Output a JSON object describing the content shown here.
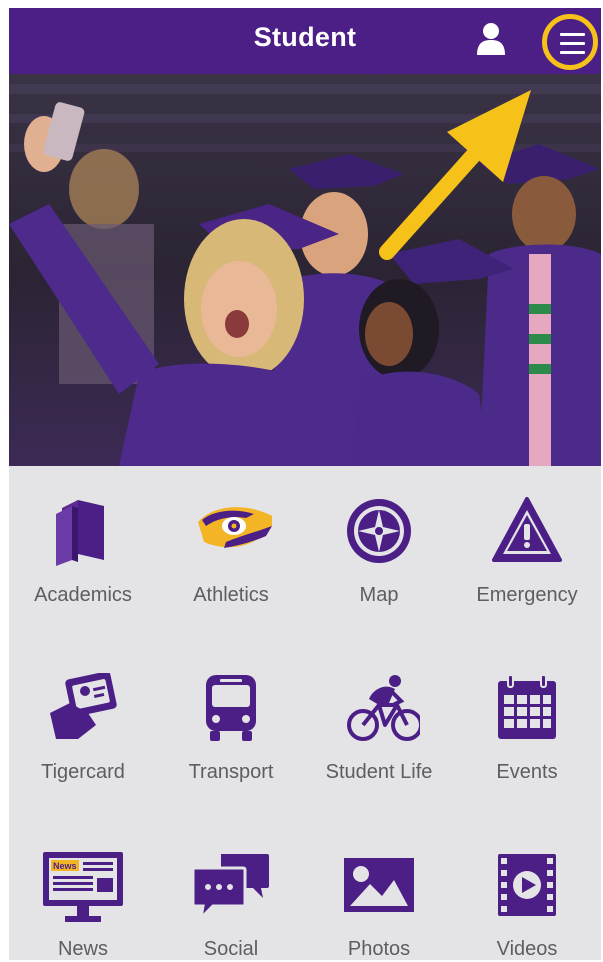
{
  "header": {
    "title": "Student",
    "profile_icon": "person-icon",
    "menu_icon": "hamburger-menu-icon",
    "highlight_color": "#f6c21a",
    "brand_color": "#4b1f86"
  },
  "grid": {
    "tiles": [
      {
        "label": "Academics",
        "icon": "books-icon"
      },
      {
        "label": "Athletics",
        "icon": "tiger-eye-icon"
      },
      {
        "label": "Map",
        "icon": "compass-icon"
      },
      {
        "label": "Emergency",
        "icon": "warning-icon"
      },
      {
        "label": "Tigercard",
        "icon": "id-card-icon"
      },
      {
        "label": "Transport",
        "icon": "bus-icon"
      },
      {
        "label": "Student Life",
        "icon": "cyclist-icon"
      },
      {
        "label": "Events",
        "icon": "calendar-icon"
      },
      {
        "label": "News",
        "icon": "news-monitor-icon",
        "icon_text": "News"
      },
      {
        "label": "Social",
        "icon": "chat-bubbles-icon"
      },
      {
        "label": "Photos",
        "icon": "photo-icon"
      },
      {
        "label": "Videos",
        "icon": "video-film-icon"
      }
    ]
  }
}
